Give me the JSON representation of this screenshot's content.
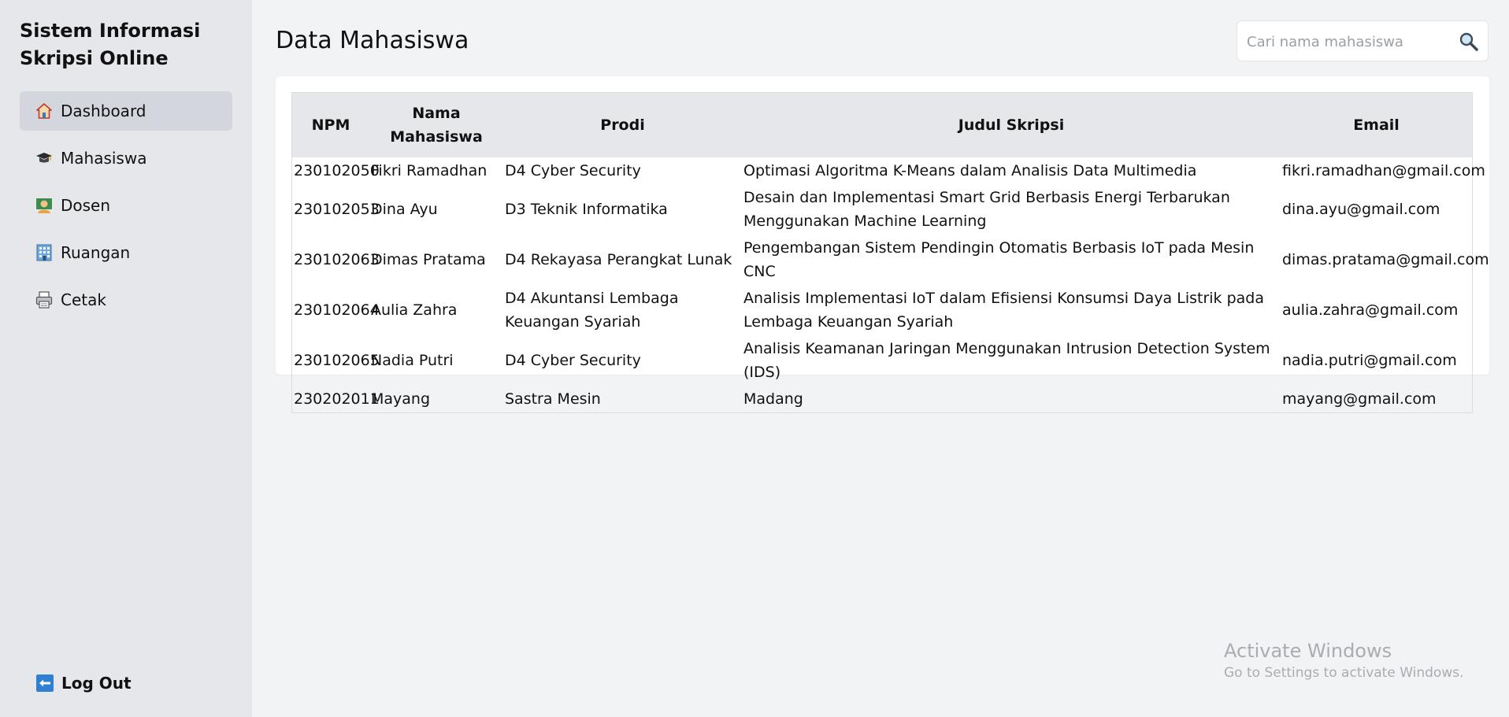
{
  "app": {
    "title_line1": "Sistem Informasi",
    "title_line2": "Skripsi Online"
  },
  "sidebar": {
    "items": [
      {
        "label": "Dashboard",
        "icon": "house-icon",
        "active": true
      },
      {
        "label": "Mahasiswa",
        "icon": "graduation-cap-icon",
        "active": false
      },
      {
        "label": "Dosen",
        "icon": "teacher-icon",
        "active": false
      },
      {
        "label": "Ruangan",
        "icon": "building-icon",
        "active": false
      },
      {
        "label": "Cetak",
        "icon": "printer-icon",
        "active": false
      }
    ],
    "logout_label": "Log Out",
    "logout_icon": "left-arrow-icon"
  },
  "main": {
    "page_title": "Data Mahasiswa",
    "search": {
      "placeholder": "Cari nama mahasiswa",
      "value": "",
      "icon": "search-icon"
    },
    "table": {
      "headers": [
        "NPM",
        "Nama Mahasiswa",
        "Prodi",
        "Judul Skripsi",
        "Email"
      ],
      "rows": [
        [
          "230102050",
          "Fikri Ramadhan",
          "D4 Cyber Security",
          "Optimasi Algoritma K-Means dalam Analisis Data Multimedia",
          "fikri.ramadhan@gmail.com"
        ],
        [
          "230102053",
          "Dina Ayu",
          "D3 Teknik Informatika",
          "Desain dan Implementasi Smart Grid Berbasis Energi Terbarukan Menggunakan Machine Learning",
          "dina.ayu@gmail.com"
        ],
        [
          "230102063",
          "Dimas Pratama",
          "D4 Rekayasa Perangkat Lunak",
          "Pengembangan Sistem Pendingin Otomatis Berbasis IoT pada Mesin CNC",
          "dimas.pratama@gmail.com"
        ],
        [
          "230102064",
          "Aulia Zahra",
          "D4 Akuntansi Lembaga Keuangan Syariah",
          "Analisis Implementasi IoT dalam Efisiensi Konsumsi Daya Listrik pada Lembaga Keuangan Syariah",
          "aulia.zahra@gmail.com"
        ],
        [
          "230102065",
          "Nadia Putri",
          "D4 Cyber Security",
          "Analisis Keamanan Jaringan Menggunakan Intrusion Detection System (IDS)",
          "nadia.putri@gmail.com"
        ],
        [
          "230202011",
          "Mayang",
          "Sastra Mesin",
          "Madang",
          "mayang@gmail.com"
        ]
      ]
    }
  },
  "watermark": {
    "title": "Activate Windows",
    "subtitle": "Go to Settings to activate Windows."
  }
}
